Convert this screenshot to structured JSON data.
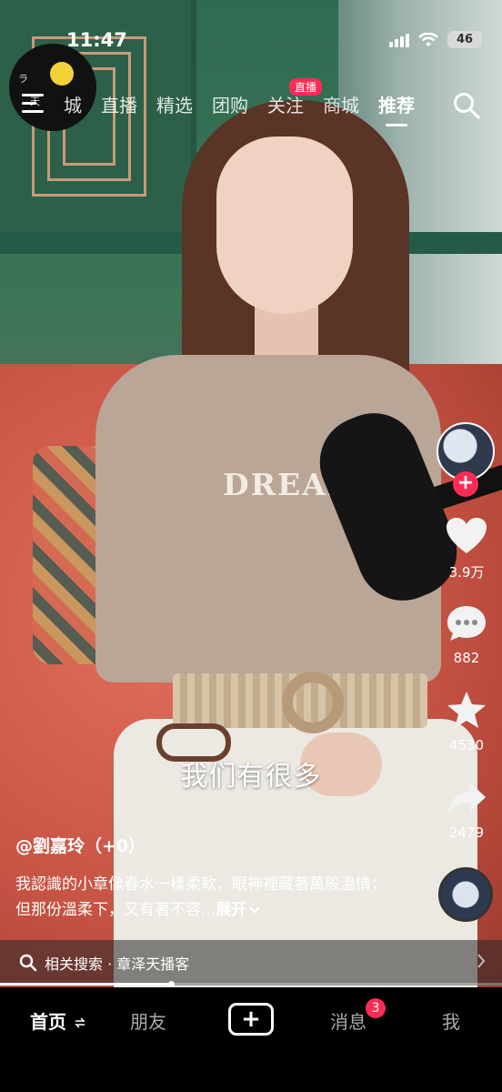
{
  "status_bar": {
    "time": "11:47",
    "battery": "46"
  },
  "top_nav": {
    "tabs": [
      "城",
      "直播",
      "精选",
      "团购",
      "关注",
      "商城",
      "推荐"
    ],
    "active_tab": "推荐",
    "live_badge": "直播"
  },
  "video": {
    "shirt_print": "DREAMER",
    "subtitle": "我们有很多"
  },
  "actions": {
    "likes": "3.9万",
    "comments": "882",
    "favorites": "4530",
    "shares": "2479"
  },
  "post": {
    "author": "@劉嘉玲（+0）",
    "description": "我認識的小章像春水一樣柔軟，眼神裡藏著萬般溫情；但那份溫柔下，又有著不容...",
    "expand_label": "展开"
  },
  "related_search": {
    "label": "相关搜索 · 章泽天播客"
  },
  "playback": {
    "progress": 0.34
  },
  "bottom_tabs": {
    "home": "首页",
    "friends": "朋友",
    "messages": "消息",
    "messages_badge": "3",
    "me": "我"
  },
  "colors": {
    "accent": "#fe2c55"
  }
}
